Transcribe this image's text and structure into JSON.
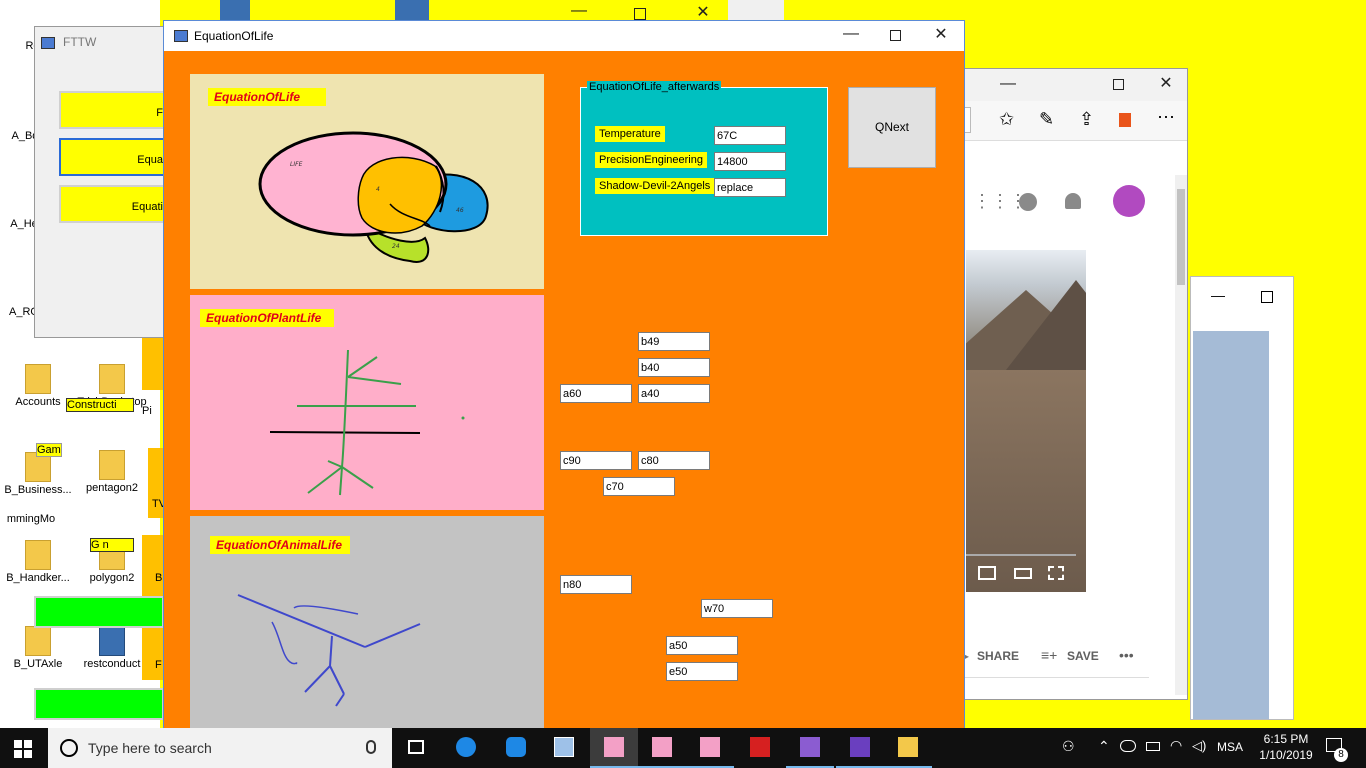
{
  "desktop": {
    "icons": [
      {
        "label": "Recy"
      },
      {
        "label": "A_Bqu"
      },
      {
        "label": "A_He"
      },
      {
        "label": "A_RO"
      },
      {
        "label": "Accounts"
      },
      {
        "label": "B_Business..."
      },
      {
        "label": "mmingMo"
      },
      {
        "label": "B_Handker..."
      },
      {
        "label": "B_UTAxle"
      },
      {
        "label": "TrishBackstop"
      },
      {
        "label": "pentagon2"
      },
      {
        "label": "polygon2"
      },
      {
        "label": "restconduct"
      }
    ],
    "fragments": [
      "Gam",
      "G  n",
      "Constructi",
      "Pi",
      "TV",
      "B",
      "F"
    ]
  },
  "fttw": {
    "title": "FTTW",
    "buttons": [
      "F",
      "Equa",
      "Equati"
    ]
  },
  "browser": {
    "actions": [
      "SHARE",
      "SAVE"
    ],
    "more": "•••"
  },
  "app": {
    "title": "EquationOfLife",
    "panels": {
      "life": {
        "label": "EquationOfLife",
        "venn": [
          {
            "label": "LIFE",
            "color": "#ffb3d1"
          },
          {
            "label": "4",
            "color": "#ffc000"
          },
          {
            "label": "46",
            "color": "#1e9be0"
          },
          {
            "label": "24",
            "color": "#b7e12a"
          }
        ],
        "bg": "#efe4b0"
      },
      "plant": {
        "label": "EquationOfPlantLife",
        "bg": "#ffaec9"
      },
      "animal": {
        "label": "EquationOfAnimalLife",
        "bg": "#c3c3c3"
      }
    },
    "group": {
      "title": "EquationOfLife_afterwards",
      "rows": [
        {
          "label": "Temperature",
          "value": "67C"
        },
        {
          "label": "PrecisionEngineering",
          "value": "14800"
        },
        {
          "label": "Shadow-Devil-2Angels",
          "value": "replace"
        }
      ]
    },
    "qnext_label": "QNext",
    "fields": {
      "b49": "b49",
      "b40": "b40",
      "a60": "a60",
      "a40": "a40",
      "c90": "c90",
      "c80": "c80",
      "c70": "c70",
      "n80": "n80",
      "w70": "w70",
      "a50": "a50",
      "e50": "e50"
    },
    "colors": {
      "client": "#ff8000",
      "label_text": "#e0001a",
      "label_bg": "#ffff00"
    }
  },
  "taskbar": {
    "search_placeholder": "Type here to search",
    "language": "MSA",
    "time": "6:15 PM",
    "date": "1/10/2019",
    "notification_count": "8"
  }
}
